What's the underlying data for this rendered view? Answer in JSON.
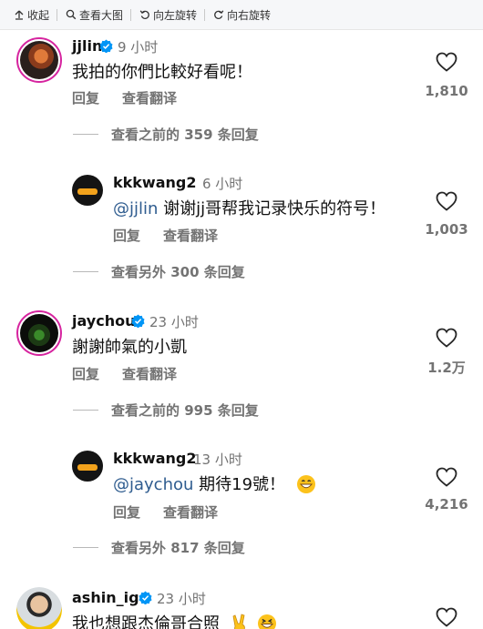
{
  "toolbar": {
    "collapse": "收起",
    "view_large": "查看大图",
    "rotate_left": "向左旋转",
    "rotate_right": "向右旋转"
  },
  "actions": {
    "reply": "回复",
    "translate": "查看翻译"
  },
  "comments": [
    {
      "username": "jjlin",
      "time": "9 小时",
      "text": "我拍的你們比較好看呢！",
      "likes": "1,810",
      "view_more": "查看之前的 359 条回复",
      "reply": {
        "username": "kkkwang2",
        "time": "6 小时",
        "mention": "@jjlin",
        "text": " 谢谢jj哥帮我记录快乐的符号！",
        "likes": "1,003",
        "view_more": "查看另外 300 条回复"
      }
    },
    {
      "username": "jaychou",
      "time": "23 小时",
      "text": "謝謝帥氣的小凱",
      "likes": "1.2万",
      "view_more": "查看之前的 995 条回复",
      "reply": {
        "username": "kkkwang2",
        "time": "13 小时",
        "mention": "@jaychou",
        "text": " 期待19號！",
        "likes": "4,216",
        "view_more": "查看另外 817 条回复"
      }
    },
    {
      "username": "ashin_ig",
      "time": "23 小时",
      "text": "我也想跟杰倫哥合照"
    }
  ],
  "icons": {
    "verified": "verified-badge-icon",
    "heart": "heart-outline-icon",
    "collapse": "collapse-icon",
    "zoom": "magnifier-icon",
    "rotate_left": "rotate-left-icon",
    "rotate_right": "rotate-right-icon"
  },
  "colors": {
    "accent_verified": "#0095f6",
    "text_secondary": "#737373",
    "mention": "#2f5c8f"
  }
}
